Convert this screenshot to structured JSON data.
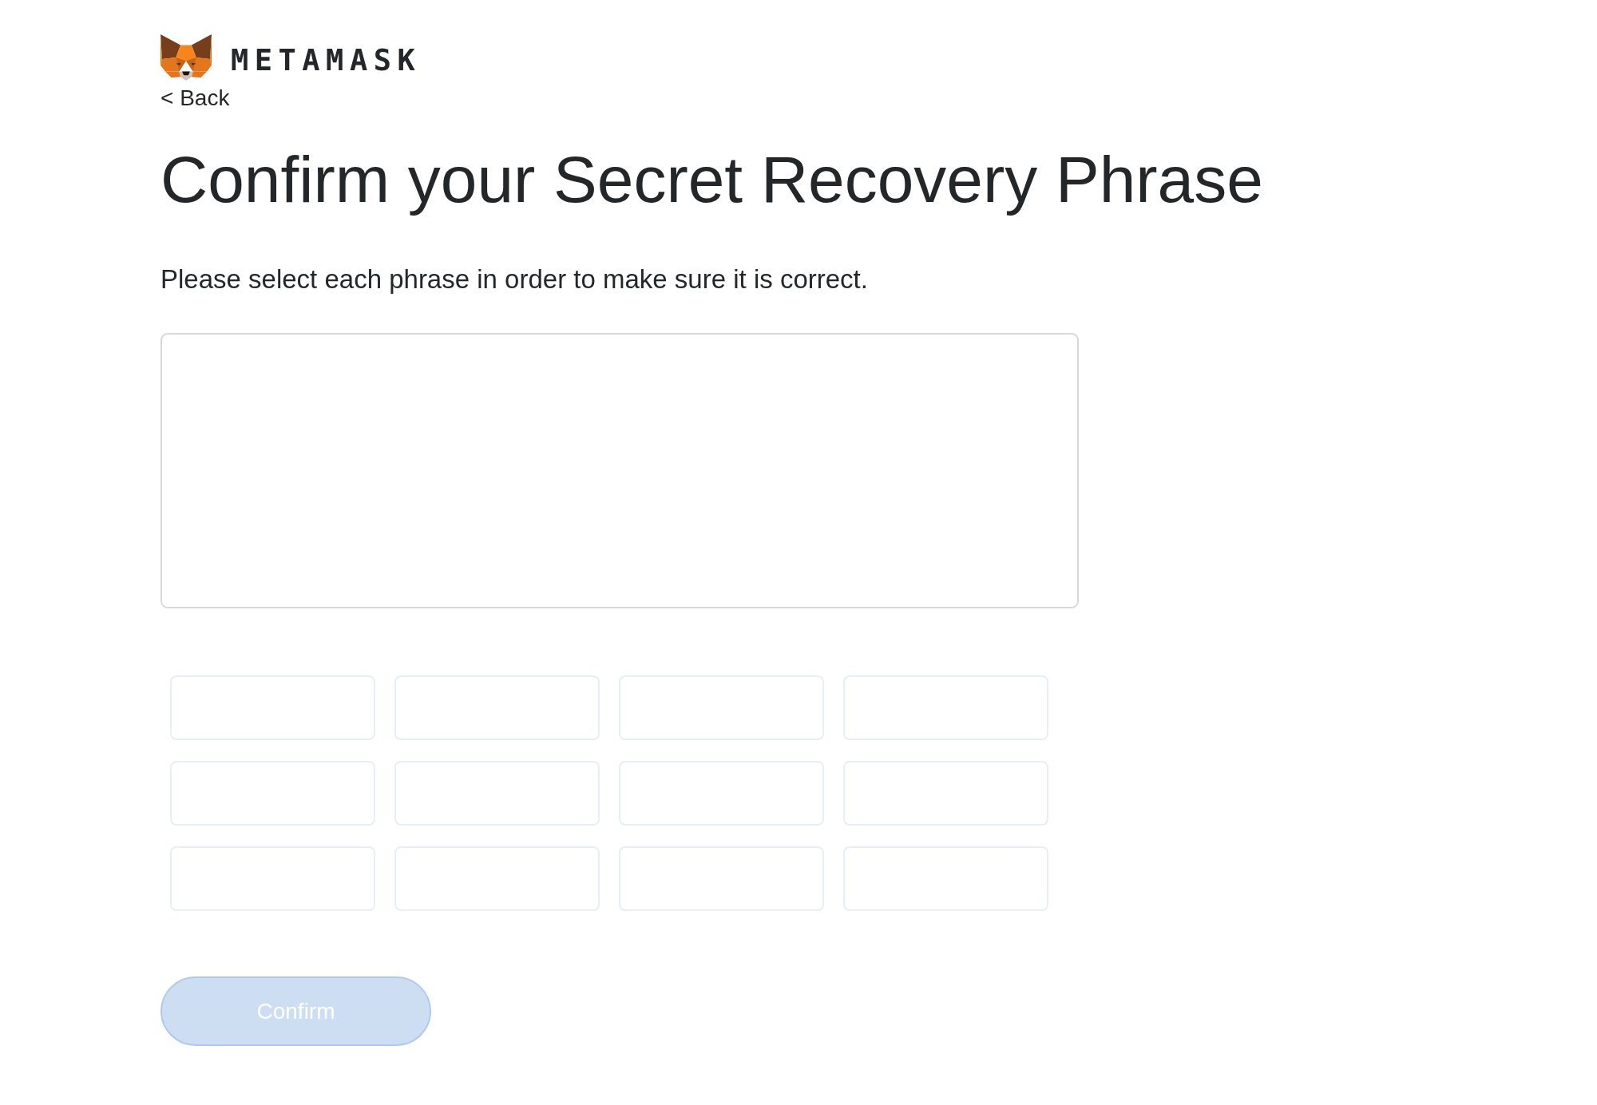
{
  "header": {
    "logo_text": "METAMASK",
    "back_link": "< Back"
  },
  "title": "Confirm your Secret Recovery Phrase",
  "instruction": "Please select each phrase in order to make sure it is correct.",
  "word_tiles": [
    {
      "selected": false
    },
    {
      "selected": false
    },
    {
      "selected": false
    },
    {
      "selected": false
    },
    {
      "selected": false
    },
    {
      "selected": false
    },
    {
      "selected": false
    },
    {
      "selected": false
    },
    {
      "selected": false
    },
    {
      "selected": false
    },
    {
      "selected": false
    },
    {
      "selected": false
    }
  ],
  "confirm_button": {
    "label": "Confirm",
    "disabled": true
  }
}
